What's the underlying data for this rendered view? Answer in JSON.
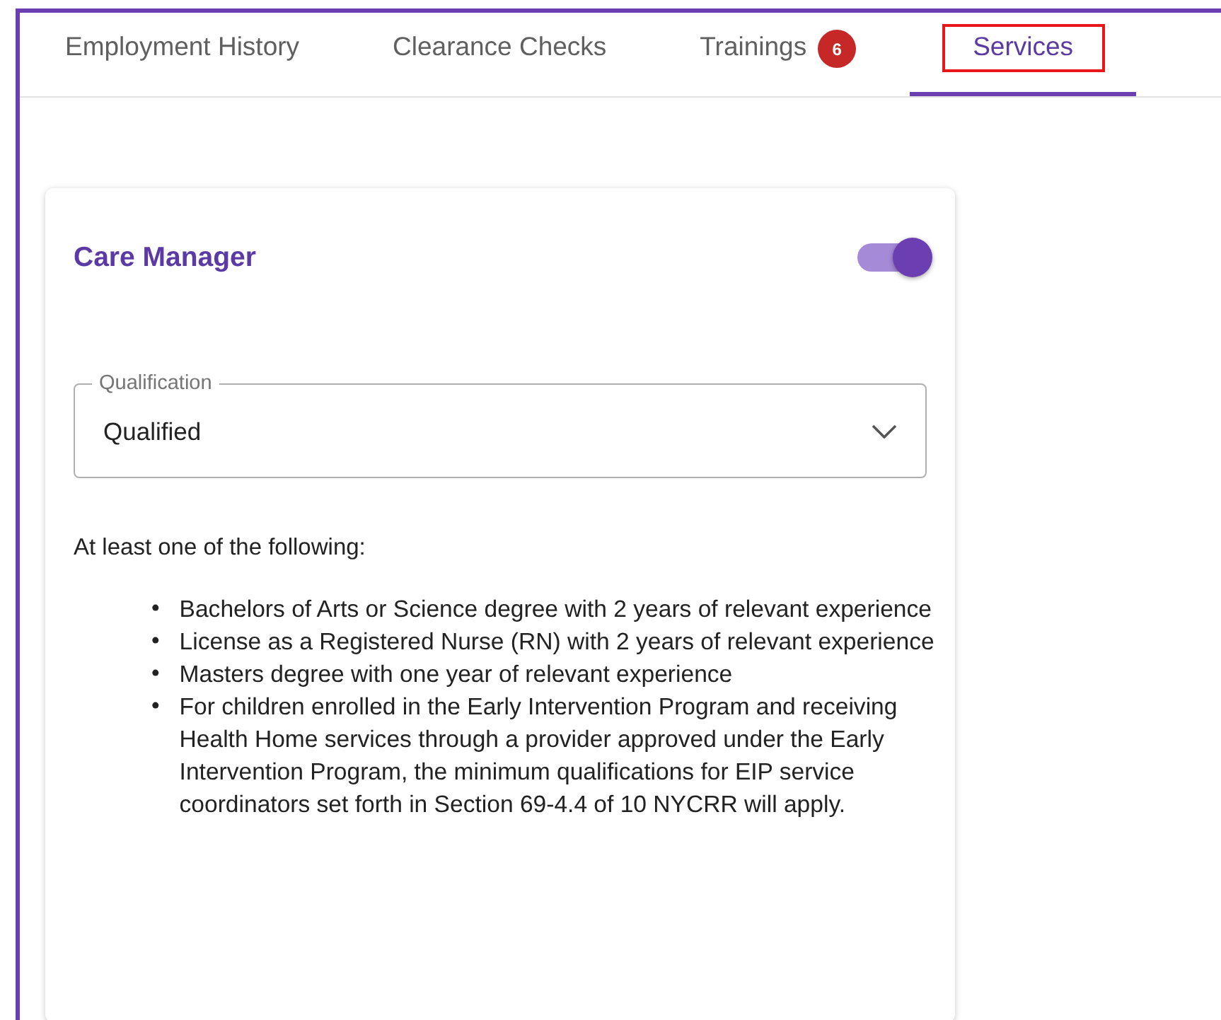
{
  "tabs": [
    {
      "label": "Employment History",
      "selected": false,
      "highlighted": false
    },
    {
      "label": "Clearance Checks",
      "selected": false,
      "highlighted": false
    },
    {
      "label": "Trainings",
      "badge": "6",
      "selected": false,
      "highlighted": false
    },
    {
      "label": "Services",
      "selected": true,
      "highlighted": true
    }
  ],
  "card": {
    "title": "Care Manager",
    "toggle_on": true,
    "select": {
      "label": "Qualification",
      "value": "Qualified"
    },
    "intro": "At least one of the following:",
    "items": [
      {
        "bullet": "•",
        "text": "Bachelors of Arts or Science degree with 2 years of relevant experience"
      },
      {
        "bullet": "•",
        "text": "License as a Registered Nurse (RN) with 2 years of relevant experience"
      },
      {
        "bullet": "•",
        "text": "Masters degree with one year of relevant experience"
      },
      {
        "bullet": "•",
        "text": "For children enrolled in the Early Intervention Program and receiving Health Home services through a provider approved under the Early Intervention Program, the minimum qualifications for EIP service coordinators set forth in Section 69-4.4 of 10 NYCRR will apply."
      }
    ]
  }
}
